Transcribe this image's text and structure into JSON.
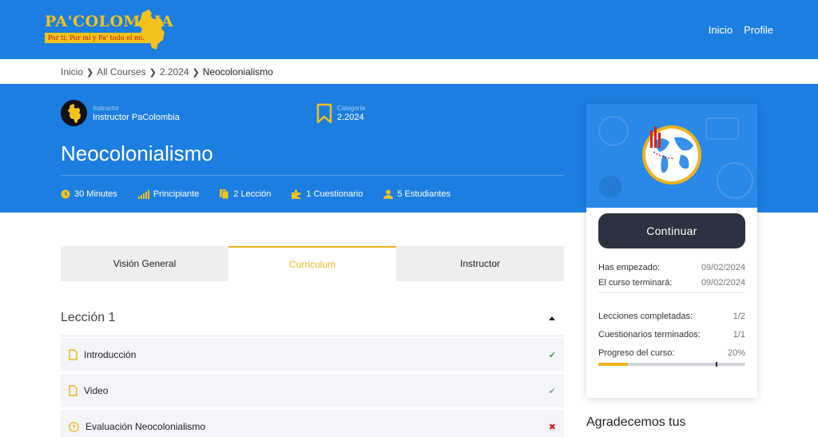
{
  "header": {
    "logo_text": "PA'COLOMBIA",
    "logo_tagline": "Por ti, Por mí y Pa' todo el mundo",
    "nav": [
      "Inicio",
      "Profile"
    ]
  },
  "breadcrumb": [
    "Inicio",
    "All Courses",
    "2.2024",
    "Neocolonialismo"
  ],
  "hero": {
    "instructor_label": "Instructor",
    "instructor_name": "Instructor PaColombia",
    "category_label": "Categoría",
    "category_value": "2.2024",
    "title": "Neocolonialismo",
    "stats": {
      "duration": "30 Minutes",
      "level": "Principiante",
      "lessons": "2 Lección",
      "quizzes": "1 Cuestionario",
      "students": "5 Estudiantes"
    }
  },
  "tabs": [
    {
      "label": "Visión General",
      "active": false
    },
    {
      "label": "Curriculum",
      "active": true
    },
    {
      "label": "Instructor",
      "active": false
    }
  ],
  "curriculum": {
    "section_title": "Lección 1",
    "items": [
      {
        "title": "Introducción",
        "type": "page",
        "status": "complete-green"
      },
      {
        "title": "Video",
        "type": "page",
        "status": "complete-gray"
      },
      {
        "title": "Evaluación Neocolonialismo",
        "type": "quiz",
        "status": "failed"
      }
    ]
  },
  "sidebar": {
    "continue_label": "Continuar",
    "started_label": "Has empezado:",
    "started_value": "09/02/2024",
    "ends_label": "El curso terminará:",
    "ends_value": "09/02/2024",
    "lessons_done_label": "Lecciones completadas:",
    "lessons_done_value": "1/2",
    "quizzes_done_label": "Cuestionarios terminados:",
    "quizzes_done_value": "1/1",
    "progress_label": "Progreso del curso:",
    "progress_value": "20%",
    "progress_fraction": 0.2,
    "passing_fraction": 0.8,
    "thanks_text": "Agradecemos tus"
  },
  "colors": {
    "brand_blue": "#1c7ee0",
    "accent_yellow": "#f0b31d",
    "button_dark": "#2b3240",
    "success_green": "#3aa64a",
    "fail_red": "#e02424"
  }
}
